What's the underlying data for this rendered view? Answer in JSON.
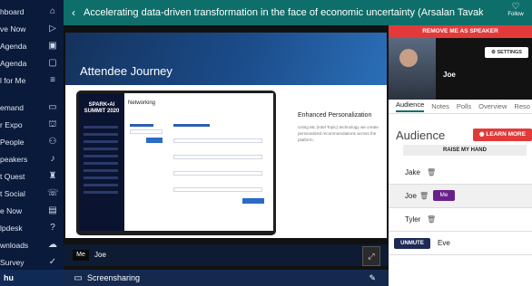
{
  "header": {
    "title": "Accelerating data-driven transformation in the face of economic uncertainty (Arsalan Tavakoli...",
    "back_icon": "chevron-left-icon",
    "follow_label": "Follow"
  },
  "sidebar": {
    "items": [
      {
        "label": "hboard",
        "icon": "home-icon",
        "glyph": "⌂"
      },
      {
        "label": "ve Now",
        "icon": "play-icon",
        "glyph": "▷"
      },
      {
        "label": "Agenda",
        "icon": "calendar-plus-icon",
        "glyph": "▣"
      },
      {
        "label": "Agenda",
        "icon": "calendar-icon",
        "glyph": "▢"
      },
      {
        "label": "l for Me",
        "icon": "sliders-icon",
        "glyph": "≡"
      },
      {
        "label": "emand",
        "icon": "video-icon",
        "glyph": "▭"
      },
      {
        "label": "r Expo",
        "icon": "booth-icon",
        "glyph": "⛫"
      },
      {
        "label": "People",
        "icon": "people-icon",
        "glyph": "⚇"
      },
      {
        "label": "peakers",
        "icon": "microphone-icon",
        "glyph": "♪"
      },
      {
        "label": "t Quest",
        "icon": "trophy-icon",
        "glyph": "♜"
      },
      {
        "label": "t Social",
        "icon": "chat-icon",
        "glyph": "☏"
      },
      {
        "label": "e Now",
        "icon": "tv-icon",
        "glyph": "▤"
      },
      {
        "label": "lpdesk",
        "icon": "help-icon",
        "glyph": "?"
      },
      {
        "label": "wnloads",
        "icon": "cloud-download-icon",
        "glyph": "☁"
      },
      {
        "label": "Survey",
        "icon": "survey-check-icon",
        "glyph": "✓"
      },
      {
        "label": "og Out",
        "icon": "logout-lock-icon",
        "glyph": "⎋"
      }
    ],
    "footer": "hu"
  },
  "slide": {
    "banner_title": "Attendee Journey",
    "screen_brand_line1": "SPARK•AI",
    "screen_brand_line2": "SUMMIT 2020",
    "screen_heading": "Networking",
    "right_title": "Enhanced Personalization",
    "right_text": "Using ML (Intel Topic) technology we create personalized recommendations across the platform."
  },
  "presenter": {
    "me_label": "Me",
    "name": "Joe",
    "expand_icon": "expand-icon"
  },
  "screenshare": {
    "label": "Screensharing",
    "icon": "monitor-icon",
    "pin_icon": "pin-icon"
  },
  "panel": {
    "remove_label": "REMOVE ME AS SPEAKER",
    "settings_label": "⚙ SETTINGS",
    "camera_name": "Joe",
    "tabs": [
      "Audience",
      "Notes",
      "Polls",
      "Overview",
      "Reso"
    ],
    "audience_title": "Audience",
    "learn_more_label": "◉ LEARN MORE",
    "raise_hand_label": "RAISE MY HAND",
    "members": [
      {
        "name": "Jake"
      },
      {
        "name": "Joe",
        "tag": "Me"
      },
      {
        "name": "Tyler"
      }
    ],
    "unmute_label": "UNMUTE",
    "unmute_name": "Eve"
  },
  "colors": {
    "header": "#0e6f6a",
    "danger": "#e23a3a",
    "sidebar": "#0a1a3a",
    "me_tag": "#6a1f8a"
  }
}
